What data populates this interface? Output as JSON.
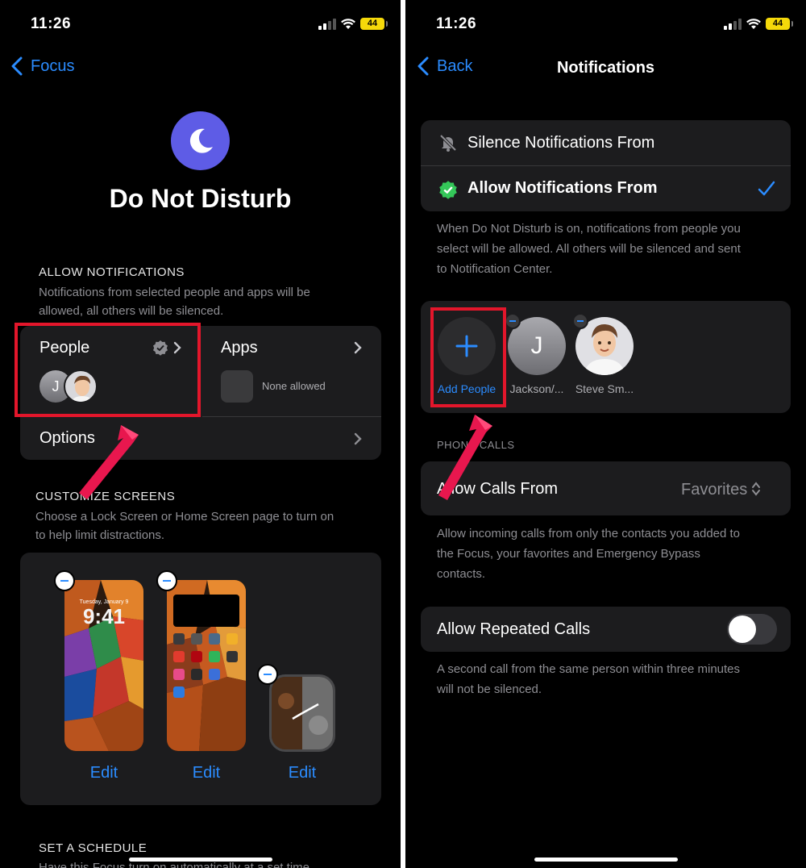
{
  "left": {
    "status": {
      "time": "11:26",
      "battery": "44"
    },
    "back_label": "Focus",
    "title": "Do Not Disturb",
    "allow": {
      "heading": "ALLOW NOTIFICATIONS",
      "description_1": "Notifications from selected people and apps will be",
      "description_2": "allowed, all others will be silenced.",
      "people_label": "People",
      "people_avatar_initial": "J",
      "apps_label": "Apps",
      "apps_none": "None allowed",
      "options_label": "Options"
    },
    "customize": {
      "heading": "CUSTOMIZE SCREENS",
      "description_1": "Choose a Lock Screen or Home Screen page to turn on",
      "description_2": "to help limit distractions.",
      "lock_date": "Tuesday, January 9",
      "lock_time": "9:41",
      "edit_1": "Edit",
      "edit_2": "Edit",
      "edit_3": "Edit"
    },
    "schedule": {
      "heading": "SET A SCHEDULE",
      "description": "Have this Focus turn on automatically at a set time"
    }
  },
  "right": {
    "status": {
      "time": "11:26",
      "battery": "44"
    },
    "back_label": "Back",
    "title": "Notifications",
    "mode": {
      "silence_label": "Silence Notifications From",
      "allow_label": "Allow Notifications From",
      "description_1": "When Do Not Disturb is on, notifications from people you",
      "description_2": "select will be allowed. All others will be silenced and sent",
      "description_3": "to Notification Center."
    },
    "people": {
      "add_label": "Add People",
      "person_1_initial": "J",
      "person_1_name": "Jackson/...",
      "person_2_name": "Steve Sm..."
    },
    "calls": {
      "heading": "PHONE CALLS",
      "allow_from_label": "Allow Calls From",
      "allow_from_value": "Favorites",
      "description_1": "Allow incoming calls from only the contacts you added to",
      "description_2": "the Focus, your favorites and Emergency Bypass",
      "description_3": "contacts.",
      "repeated_label": "Allow Repeated Calls",
      "repeated_on": false,
      "repeated_desc_1": "A second call from the same person within three minutes",
      "repeated_desc_2": "will not be silenced."
    }
  },
  "colors": {
    "accent": "#2b8cff",
    "focus_purple": "#5e5ce6",
    "highlight_red": "#e3162b",
    "arrow_pink": "#e8174e",
    "panel": "#1c1c1e",
    "check_green": "#34c759"
  },
  "icons": [
    "chevron-left-icon",
    "moon-icon",
    "verified-badge-icon",
    "chevron-right-icon",
    "bell-slash-icon",
    "checkmark-icon",
    "plus-icon",
    "minus-icon",
    "up-down-chevron-icon",
    "wifi-icon",
    "signal-icon",
    "battery-icon",
    "red-arrow-annotation"
  ]
}
